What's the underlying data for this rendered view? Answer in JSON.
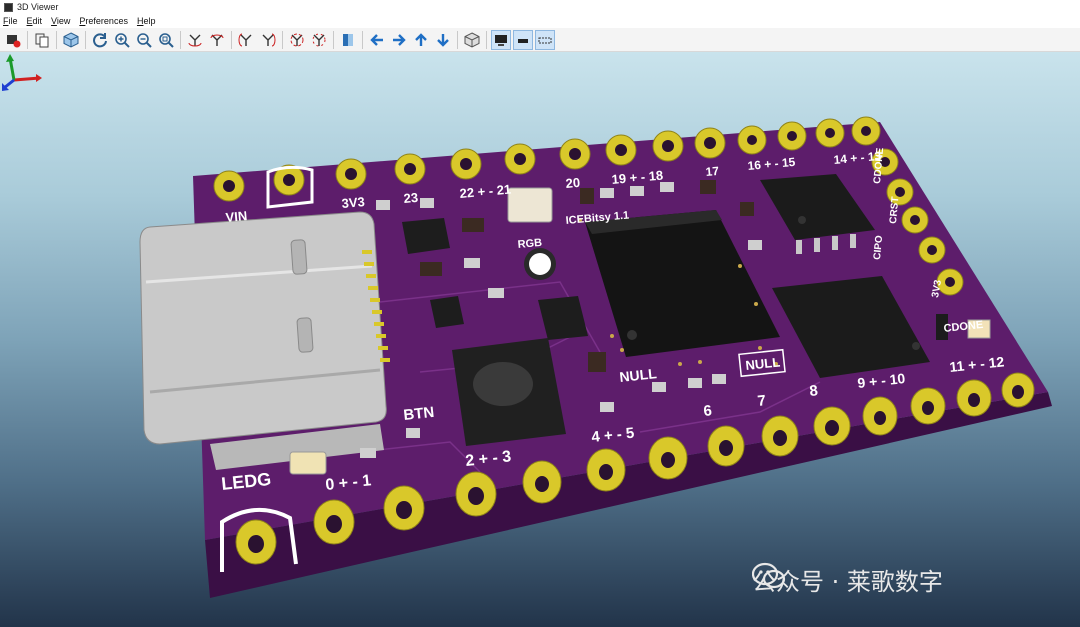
{
  "window": {
    "title": "3D Viewer"
  },
  "menu": [
    "File",
    "Edit",
    "View",
    "Preferences",
    "Help"
  ],
  "toolbar": {
    "buttons": [
      "reload-board",
      "copy-image",
      "view-3d",
      "refresh",
      "zoom-in",
      "zoom-out",
      "zoom-fit",
      "rotate-x-cw",
      "rotate-x-ccw",
      "rotate-y-cw",
      "rotate-y-ccw",
      "rotate-z-cw",
      "rotate-z-ccw",
      "flip-board",
      "pan-left",
      "pan-right",
      "pan-up",
      "pan-down",
      "ortho-toggle",
      "render-mode-1",
      "render-mode-2",
      "render-mode-3"
    ]
  },
  "pcb": {
    "top_labels": {
      "vin": "VIN",
      "v3v3": "3V3",
      "p23": "23",
      "p22_21": "22 + - 21",
      "p20": "20",
      "p19_18": "19 + - 18",
      "p17": "17",
      "p16_15": "16 + - 15",
      "p14_13": "14 + - 13",
      "icebreaker": "ICEBitsy 1.1"
    },
    "side_labels": {
      "cdone": "CDONE",
      "crst": "CRST",
      "cipo": "CIPO",
      "v3v3_right": "3V3",
      "cdone2": "CDONE"
    },
    "bottom_labels": {
      "ledg": "LEDG",
      "p0_1": "0 + - 1",
      "btn": "BTN",
      "p2_3": "2 + - 3",
      "p4_5": "4 + - 5",
      "p6": "6",
      "p7": "7",
      "p8": "8",
      "p9_10": "9 + - 10",
      "p11_12": "11 + - 12",
      "null1": "NULL",
      "null2": "NULL",
      "rgb": "RGB"
    }
  },
  "colors": {
    "board": "#5a1a66",
    "pad": "#d9c82a",
    "chip": "#1c1c1c",
    "usb": "#c8c8c8"
  },
  "watermark": {
    "text": "公众号 · 莱歌数字"
  }
}
